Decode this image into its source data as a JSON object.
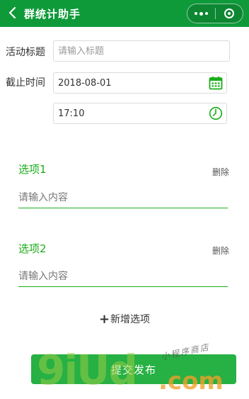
{
  "navbar": {
    "title": "群统计助手",
    "back_icon": "chevron-left-icon",
    "more_icon": "more-dots-icon",
    "close_icon": "mini-program-close-icon",
    "color": "#0f9a3a"
  },
  "form": {
    "title_label": "活动标题",
    "title_placeholder": "请输入标题",
    "deadline_label": "截止时间",
    "deadline_date": "2018-08-01",
    "deadline_time": "17:10",
    "date_icon": "calendar-icon",
    "time_icon": "clock-icon"
  },
  "options": [
    {
      "label": "选项1",
      "delete_label": "删除",
      "placeholder": "请输入内容"
    },
    {
      "label": "选项2",
      "delete_label": "删除",
      "placeholder": "请输入内容"
    }
  ],
  "add_option": {
    "plus": "+",
    "label": "新增选项"
  },
  "submit": {
    "label": "提交发布",
    "color": "#27b043"
  },
  "watermark": {
    "main": "9iUd",
    "domain": ".com",
    "hand": "小程序商店"
  },
  "colors": {
    "accent": "#1aad19"
  }
}
